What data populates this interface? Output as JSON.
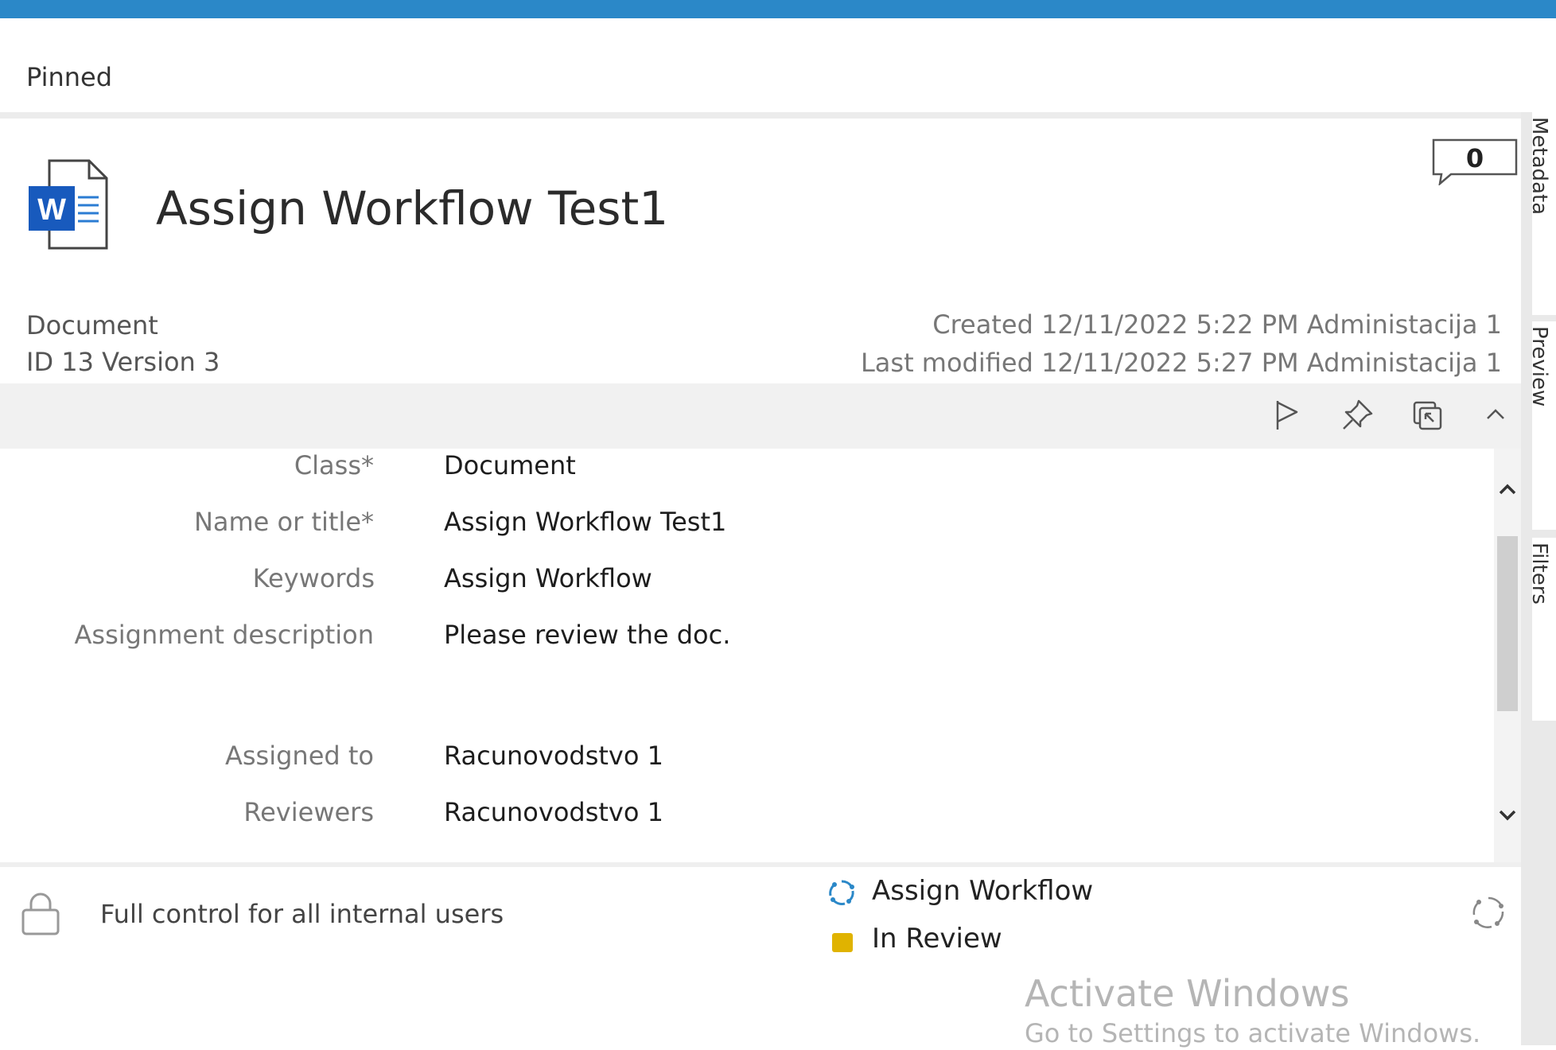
{
  "header": {
    "pinned_label": "Pinned"
  },
  "document": {
    "title": "Assign Workflow Test1",
    "icon_letter": "W",
    "comment_count": "0",
    "type": "Document",
    "id_version": "ID 13  Version 3",
    "created": "Created 12/11/2022 5:22 PM Administacija 1",
    "last_modified": "Last modified 12/11/2022 5:27 PM Administacija 1"
  },
  "toolbar": {
    "icons": [
      "flag-icon",
      "pin-icon",
      "window-icon",
      "collapse-chevron-icon"
    ]
  },
  "properties": [
    {
      "label": "Class",
      "required_mark": "*",
      "value": "Document"
    },
    {
      "label": "Name or title",
      "required_mark": "*",
      "value": "Assign Workflow Test1"
    },
    {
      "label": "Keywords",
      "required_mark": "",
      "value": "Assign Workflow"
    },
    {
      "label": "Assignment description",
      "required_mark": "",
      "value": "Please review the doc."
    },
    {
      "label": "Assigned to",
      "required_mark": "",
      "value": "Racunovodstvo 1"
    },
    {
      "label": "Reviewers",
      "required_mark": "",
      "value": "Racunovodstvo 1"
    }
  ],
  "footer": {
    "permissions": "Full control for all internal users",
    "workflow": "Assign Workflow",
    "state": "In Review",
    "state_color": "#e0b300"
  },
  "side_tabs": [
    "Metadata",
    "Preview",
    "Filters"
  ],
  "watermark": {
    "line1": "Activate Windows",
    "line2": "Go to Settings to activate Windows."
  },
  "colors": {
    "accent": "#2b88c8"
  }
}
